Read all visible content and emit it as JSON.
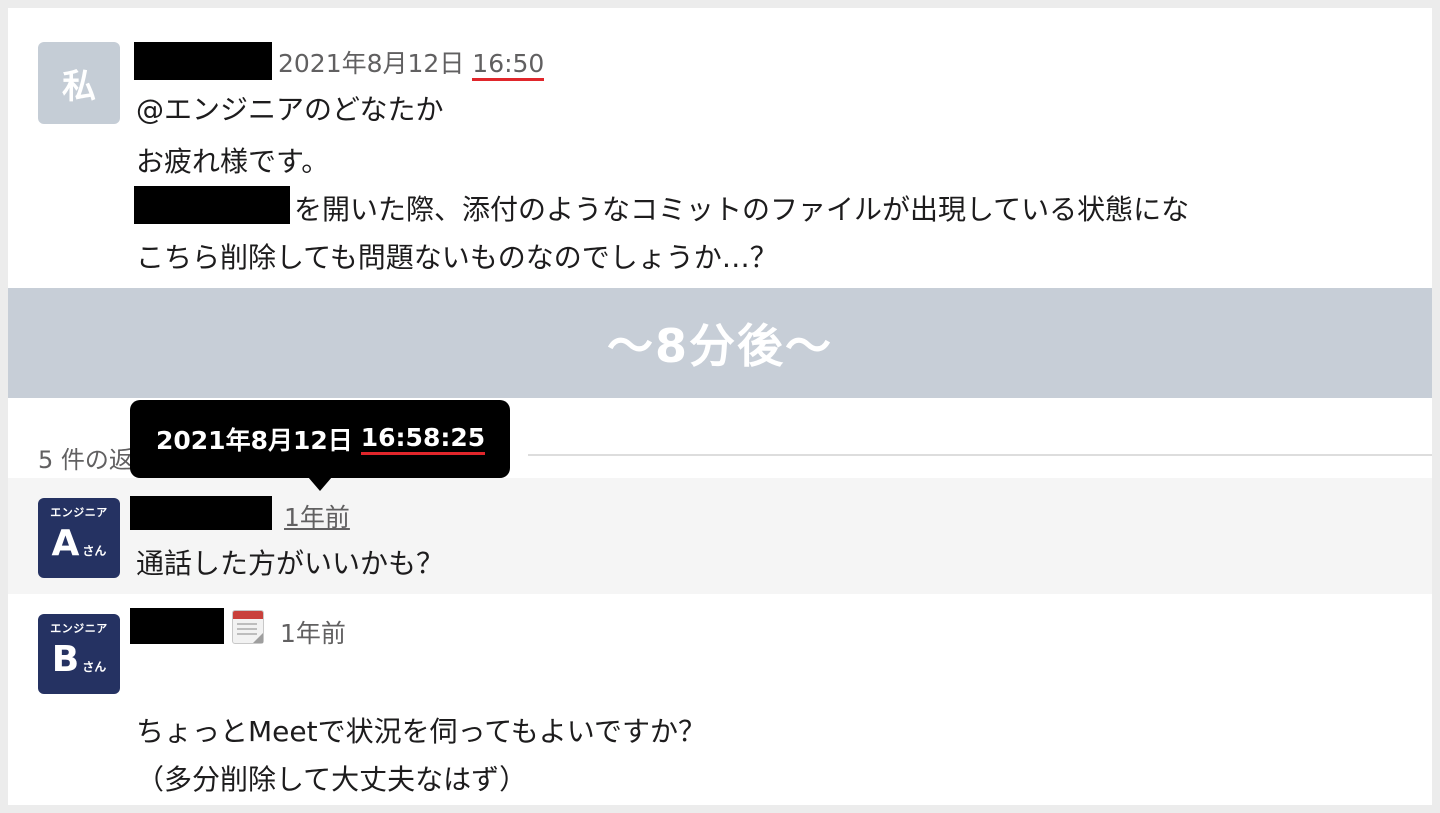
{
  "first_message": {
    "avatar_text": "私",
    "date": "2021年8月12日",
    "time": "16:50",
    "lines": [
      "@エンジニアのどなたか",
      "お疲れ様です。",
      "を開いた際、添付のようなコミットのファイルが出現している状態にな",
      "こちら削除しても問題ないものなのでしょうか…？"
    ]
  },
  "banner": {
    "text": "〜8分後〜"
  },
  "replies": {
    "count_label": "5 件の返信"
  },
  "tooltip": {
    "date": "2021年8月12日",
    "time": "16:58:25"
  },
  "reply_a": {
    "avatar_role": "エンジニア",
    "avatar_letter": "A",
    "avatar_suffix": "さん",
    "ago": "1年前",
    "text": "通話した方がいいかも？"
  },
  "reply_b": {
    "avatar_role": "エンジニア",
    "avatar_letter": "B",
    "avatar_suffix": "さん",
    "status_icon": "calendar-icon",
    "ago": "1年前",
    "lines": [
      "ちょっとMeetで状況を伺ってもよいですか？",
      "（多分削除して大丈夫なはず）"
    ]
  },
  "colors": {
    "banner_bg": "#c7ced7",
    "avatar_me_bg": "#c5cdd6",
    "avatar_eng_bg": "#253262",
    "underline_red": "#e0262b"
  }
}
